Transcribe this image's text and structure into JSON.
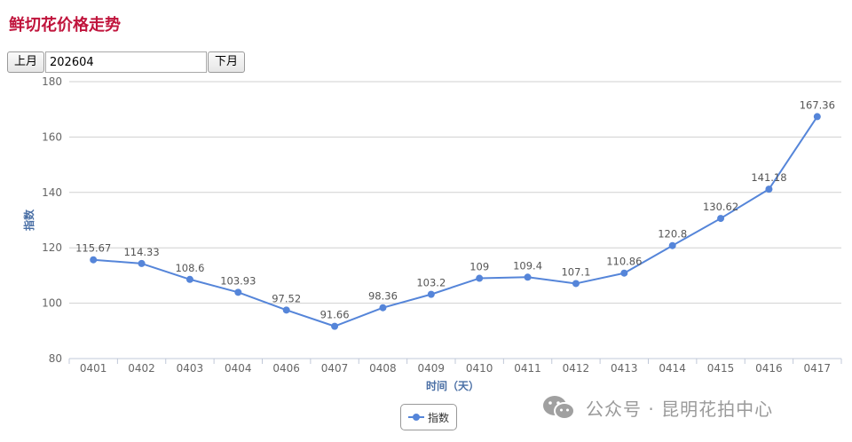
{
  "page": {
    "title": "鲜切花价格走势"
  },
  "toolbar": {
    "prev_label": "上月",
    "month_value": "202604",
    "next_label": "下月"
  },
  "watermark": {
    "icon": "wechat-icon",
    "text": "公众号 · 昆明花拍中心"
  },
  "chart_data": {
    "type": "line",
    "categories": [
      "0401",
      "0402",
      "0403",
      "0404",
      "0406",
      "0407",
      "0408",
      "0409",
      "0410",
      "0411",
      "0412",
      "0413",
      "0414",
      "0415",
      "0416",
      "0417"
    ],
    "series": [
      {
        "name": "指数",
        "values": [
          115.67,
          114.33,
          108.6,
          103.93,
          97.52,
          91.66,
          98.36,
          103.2,
          109,
          109.4,
          107.1,
          110.86,
          120.8,
          130.62,
          141.18,
          167.36
        ],
        "labels": [
          "115.67",
          "114.33",
          "108.6",
          "103.93",
          "97.52",
          "91.66",
          "98.36",
          "103.2",
          "109",
          "109.4",
          "107.1",
          "110.86",
          "120.8",
          "130.62",
          "141.18",
          "167.36"
        ],
        "color": "#5585d9"
      }
    ],
    "xlabel": "时间（天）",
    "ylabel": "指数",
    "ylim": [
      80,
      180
    ],
    "yticks": [
      "80",
      "100",
      "120",
      "140",
      "160",
      "180"
    ],
    "ytick_values": [
      80,
      100,
      120,
      140,
      160,
      180
    ],
    "grid": true,
    "legend": "bottom-center",
    "colors": {
      "grid": "#d0d0d0",
      "axis_text": "#666666",
      "axis_title": "#4a6fa5"
    }
  }
}
